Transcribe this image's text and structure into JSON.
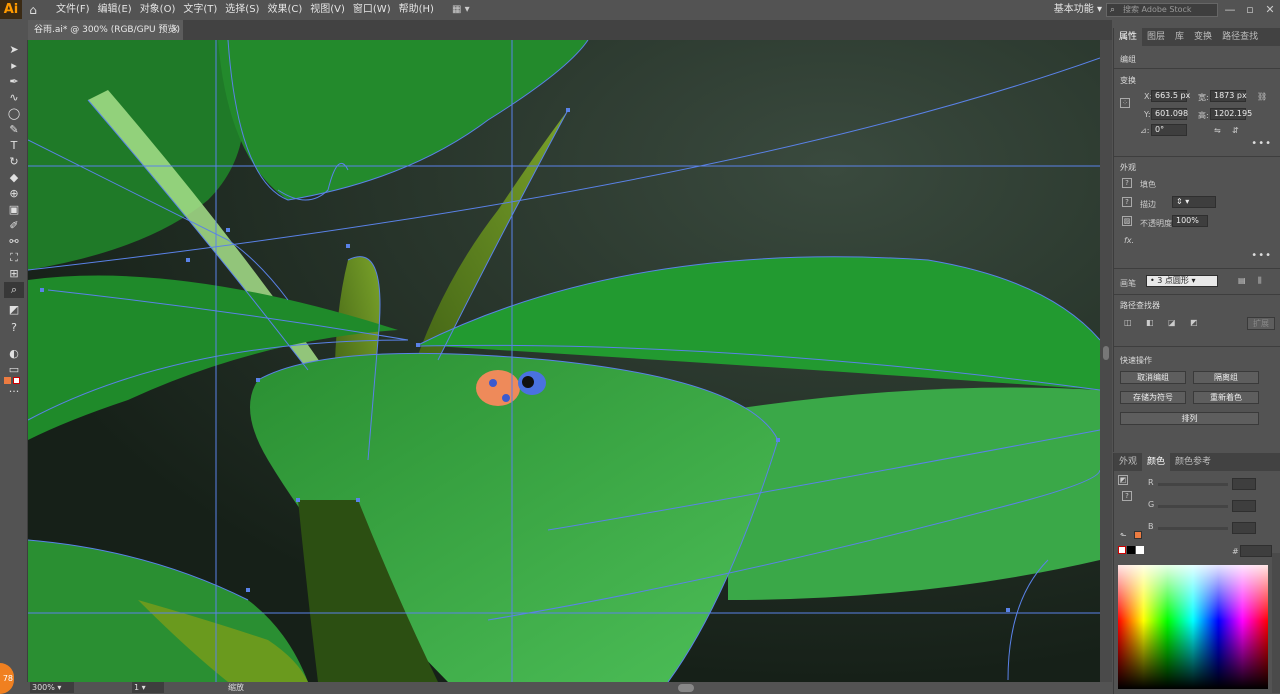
{
  "app": {
    "logo": "Ai"
  },
  "menu": [
    "文件(F)",
    "编辑(E)",
    "对象(O)",
    "文字(T)",
    "选择(S)",
    "效果(C)",
    "视图(V)",
    "窗口(W)",
    "帮助(H)"
  ],
  "workspace_label": "基本功能",
  "stock_search_placeholder": "搜索 Adobe Stock",
  "document_tab": {
    "title": "谷雨.ai* @ 300% (RGB/GPU 预览)",
    "close": "×"
  },
  "status": {
    "zoom": "300%",
    "page": "1",
    "label": "缩放"
  },
  "badge": "78",
  "properties": {
    "tabs": [
      "属性",
      "图层",
      "库",
      "变换",
      "路径查找"
    ],
    "group_label": "编组",
    "transform": {
      "title": "变换",
      "x_label": "X:",
      "x_value": "663.5 px",
      "y_label": "Y:",
      "y_value": "601.098",
      "w_label": "宽:",
      "w_value": "1873 px",
      "h_label": "高:",
      "h_value": "1202.195",
      "angle_label": "⊿:",
      "angle_value": "0°"
    },
    "appearance": {
      "title": "外观",
      "fill_label": "填色",
      "stroke_label": "描边",
      "opacity_label": "不透明度",
      "opacity_value": "100%",
      "fx_label": "fx."
    },
    "brush": {
      "label": "画笔",
      "value": "• 3 点圆形"
    },
    "pathfinder": {
      "title": "路径查找器",
      "expand": "扩展"
    },
    "quick_actions": {
      "title": "快速操作",
      "ungroup": "取消编组",
      "isolate": "隔离组",
      "save_symbol": "存储为符号",
      "recolor": "重新着色",
      "arrange": "排列"
    }
  },
  "color_panel": {
    "tabs": [
      "外观",
      "颜色",
      "颜色参考"
    ],
    "r": "R",
    "g": "G",
    "b": "B",
    "hex_prefix": "#"
  }
}
